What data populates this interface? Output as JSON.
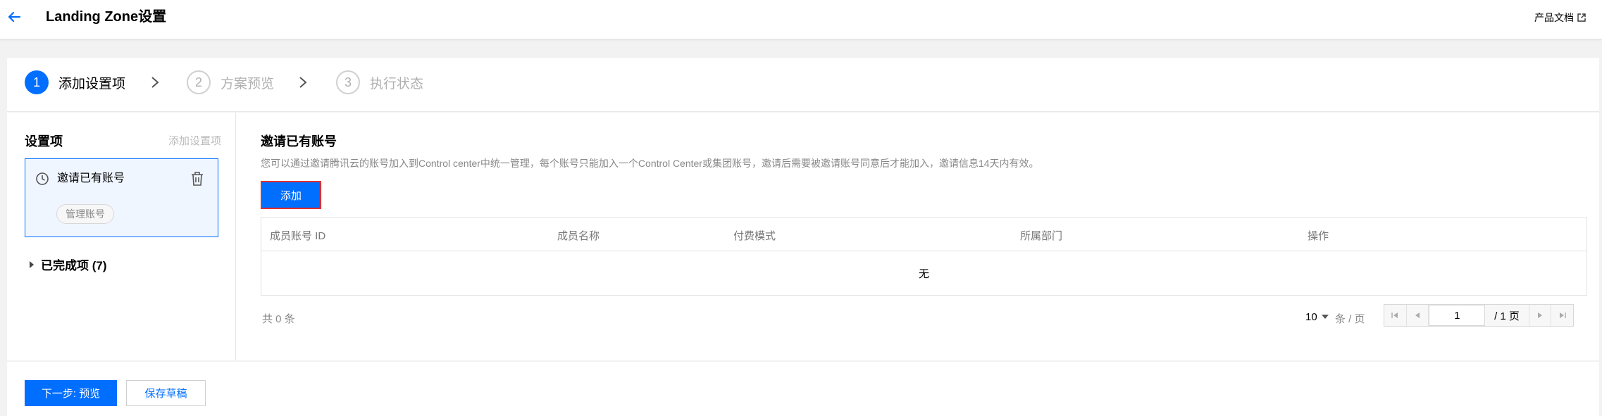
{
  "header": {
    "title": "Landing Zone设置",
    "doc_link": "产品文档"
  },
  "steps": [
    {
      "number": "1",
      "label": "添加设置项",
      "state": "active"
    },
    {
      "number": "2",
      "label": "方案预览",
      "state": "inactive"
    },
    {
      "number": "3",
      "label": "执行状态",
      "state": "inactive"
    }
  ],
  "sidebar": {
    "title": "设置项",
    "add_label": "添加设置项",
    "item": {
      "name": "邀请已有账号",
      "tag": "管理账号"
    },
    "completed_label": "已完成项 (7)"
  },
  "content": {
    "title": "邀请已有账号",
    "description": "您可以通过邀请腾讯云的账号加入到Control center中统一管理，每个账号只能加入一个Control Center或集团账号，邀请后需要被邀请账号同意后才能加入，邀请信息14天内有效。",
    "add_button": "添加",
    "table": {
      "columns": [
        "成员账号 ID",
        "成员名称",
        "付费模式",
        "所属部门",
        "操作"
      ],
      "empty_text": "无"
    },
    "pagination": {
      "total": "共 0 条",
      "page_size": "10",
      "page_size_unit": "条 / 页",
      "current_page": "1",
      "total_pages": "/ 1 页"
    }
  },
  "footer": {
    "next_button": "下一步: 预览",
    "draft_button": "保存草稿"
  },
  "colors": {
    "primary": "#006eff",
    "highlight_border": "#e03030"
  }
}
